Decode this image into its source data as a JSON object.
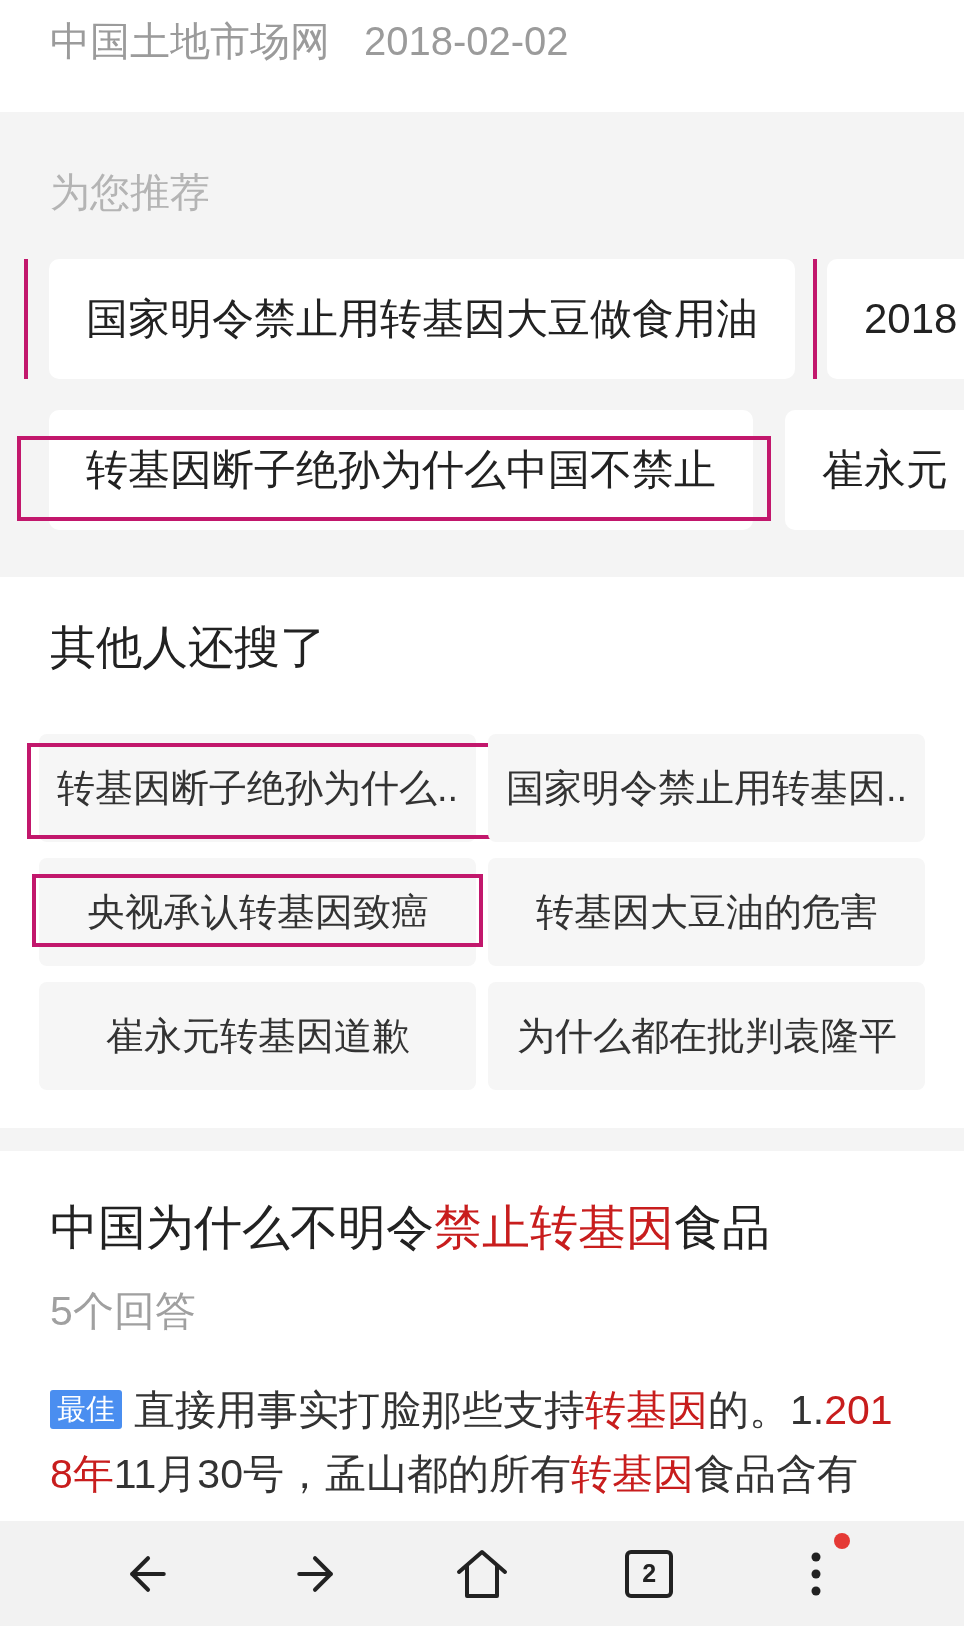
{
  "source": {
    "site": "中国土地市场网",
    "date": "2018-02-02"
  },
  "recommended": {
    "title": "为您推荐",
    "rows": [
      {
        "items": [
          {
            "text": "国家明令禁止用转基因大豆做食用油",
            "highlighted": true
          },
          {
            "text": "2018",
            "highlighted": false
          }
        ]
      },
      {
        "items": [
          {
            "text": "转基因断子绝孙为什么中国不禁止",
            "highlighted": true
          },
          {
            "text": "崔永元",
            "highlighted": false
          }
        ]
      }
    ]
  },
  "related_searches": {
    "title": "其他人还搜了",
    "items": [
      {
        "text": "转基因断子绝孙为什么..",
        "highlighted": true
      },
      {
        "text": "国家明令禁止用转基因..",
        "highlighted": false
      },
      {
        "text": "央视承认转基因致癌",
        "highlighted": true
      },
      {
        "text": "转基因大豆油的危害",
        "highlighted": false
      },
      {
        "text": "崔永元转基因道歉",
        "highlighted": false
      },
      {
        "text": "为什么都在批判袁隆平",
        "highlighted": false
      }
    ]
  },
  "question": {
    "title": [
      {
        "text": "中国为什么不明令",
        "emphasis": false
      },
      {
        "text": "禁止转基因",
        "emphasis": true
      },
      {
        "text": "食品",
        "emphasis": false
      }
    ],
    "answer_count": "5个回答",
    "best_answer": {
      "badge": "最佳",
      "text": [
        {
          "text": "直接用事实打脸那些支持",
          "emphasis": false
        },
        {
          "text": "转基因",
          "emphasis": true
        },
        {
          "text": "的。1.",
          "emphasis": false
        },
        {
          "text": "2018年",
          "emphasis": true
        },
        {
          "text": "11月30号，孟山都的所有",
          "emphasis": false
        },
        {
          "text": "转基因",
          "emphasis": true
        },
        {
          "text": "食品含有",
          "emphasis": false
        }
      ]
    }
  },
  "nav": {
    "tab_count": "2",
    "menu_notification": true
  }
}
